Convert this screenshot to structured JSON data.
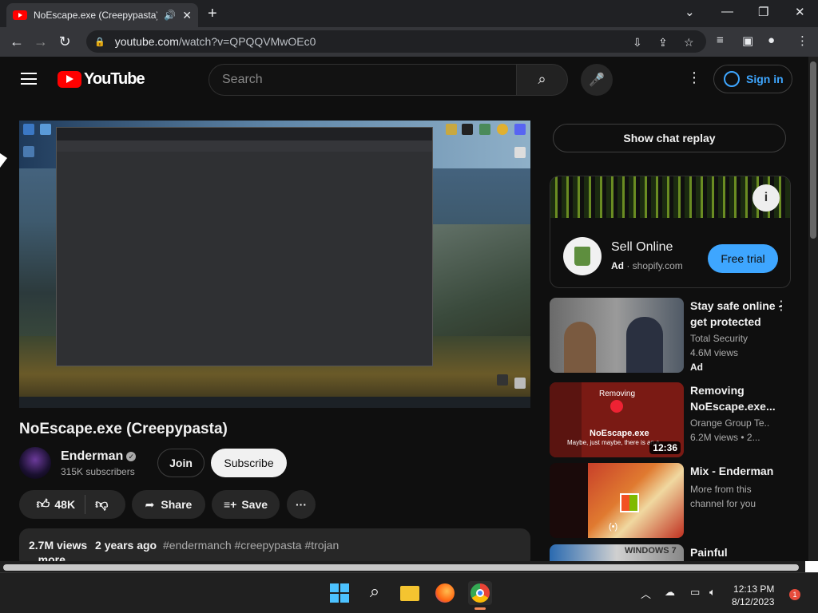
{
  "browser": {
    "tab_title": "NoEscape.exe (Creepypasta)",
    "url_host": "youtube.com",
    "url_path": "/watch?v=QPQQVMwOEc0"
  },
  "header": {
    "logo_text": "YouTube",
    "search_placeholder": "Search",
    "signin_label": "Sign in"
  },
  "video": {
    "title": "NoEscape.exe (Creepypasta)",
    "channel": "Enderman",
    "subscribers": "315K subscribers",
    "join_label": "Join",
    "subscribe_label": "Subscribe",
    "likes": "48K",
    "share_label": "Share",
    "save_label": "Save",
    "views": "2.7M views",
    "age": "2 years ago",
    "tags": "#endermanch #creepypasta #trojan",
    "more_label": "...more"
  },
  "sidebar": {
    "chat_replay_label": "Show chat replay",
    "ad": {
      "name": "Sell Online",
      "ad_badge": "Ad",
      "domain": "shopify.com",
      "cta": "Free trial"
    },
    "recommendations": [
      {
        "title": "Stay safe online - get protected",
        "channel": "Total Security",
        "views": "4.6M views",
        "badge": "Ad",
        "duration": ""
      },
      {
        "title": "Removing NoEscape.exe...",
        "channel": "Orange Group Te...",
        "views": "6.2M views",
        "extra": "• 2...",
        "duration": "12:36",
        "thumb_caption_top": "Removing",
        "thumb_caption_mid": "NoEscape.exe",
        "thumb_caption_sub": "Maybe, just maybe, there is an e"
      },
      {
        "title": "Mix - Enderman",
        "channel": "More from this",
        "views": "channel for you",
        "duration": ""
      },
      {
        "title": "Painful",
        "channel": "",
        "views": "",
        "duration": "",
        "thumb_caption_top": "WINDOWS 7"
      }
    ]
  },
  "taskbar": {
    "time": "12:13 PM",
    "date": "8/12/2023",
    "notifications": "1"
  },
  "colors": {
    "bg": "#0f0f0f",
    "yt_red": "#ff0000",
    "link_blue": "#3ea6ff"
  }
}
